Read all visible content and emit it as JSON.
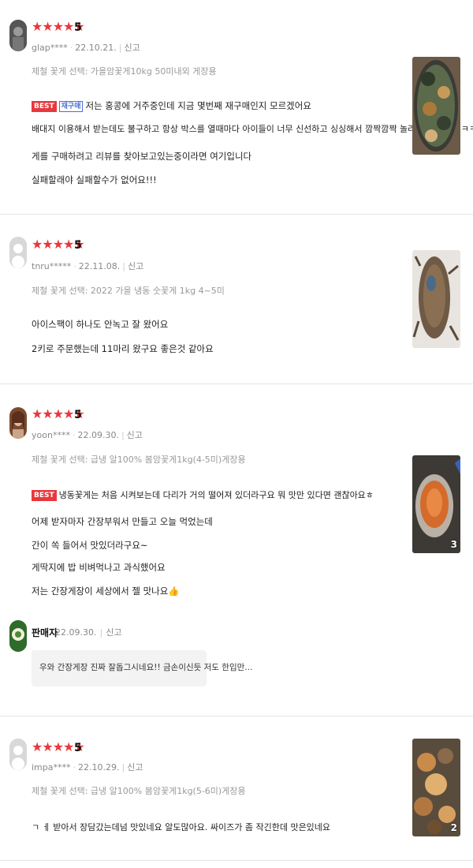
{
  "reviews": [
    {
      "stars": "★★★★★",
      "score": "5",
      "user": "glap****",
      "date": "22.10.21.",
      "report": "신고",
      "option": "제철 꽃게 선택: 가을암꽃게10kg 50미내외 게장용",
      "badges": [
        "BEST",
        "재구매"
      ],
      "lines": [
        "저는 홍콩에 거주중인데 지금 몇번째 재구매인지 모르겠어요",
        "배대지 이용해서 받는데도 불구하고 항상 박스를 열때마다 아이들이 너무 신선하고 싱싱해서 깜짝깜짝 놀라고 있습니다 ㅋㅋ",
        "게를 구매하려고 리뷰를 찾아보고있는중이라면 여기입니다",
        "실패할래야 실패할수가 없어요!!!"
      ],
      "photo_count": ""
    },
    {
      "stars": "★★★★★",
      "score": "5",
      "user": "tnru*****",
      "date": "22.11.08.",
      "report": "신고",
      "option": "제철 꽃게 선택: 2022 가을 냉동 숫꽃게 1kg 4~5미",
      "badges": [],
      "lines": [
        "아이스팩이 하나도 안녹고 잘 왔어요",
        "2키로 주문했는데 11마리 왔구요 좋은것 같아요"
      ],
      "photo_count": ""
    },
    {
      "stars": "★★★★★",
      "score": "5",
      "user": "yoon****",
      "date": "22.09.30.",
      "report": "신고",
      "option": "제철 꽃게 선택: 급냉 알100% 봄암꽃게1kg(4-5미)게장용",
      "badges": [
        "BEST"
      ],
      "lines": [
        "냉동꽃게는 처음 시켜보는데 다리가 거의 떨어져 있더라구요 뭐 맛만 있다면 괜찮아요ㅎ",
        "어제 받자마자 간장부워서 만들고 오늘 먹었는데",
        "간이 쏙 들어서 맛있더라구요~",
        "게딱지에 밥 비벼먹나고 과식했어요",
        "저는 간장게장이 세상에서 젤 맛나요👍"
      ],
      "photo_count": "3",
      "seller_reply": {
        "name": "판매자",
        "date": "22.09.30.",
        "report": "신고",
        "text": "우와 간장게장 진짜 잘돕그시네요!! 금손이신듯 저도 한입만..."
      }
    },
    {
      "stars": "★★★★★",
      "score": "5",
      "user": "impa****",
      "date": "22.10.29.",
      "report": "신고",
      "option": "제철 꽃게 선택: 급냉 알100% 봄암꽃게1kg(5-6미)게장용",
      "badges": [],
      "lines": [
        "ㄱ ㅔ 받아서 장담갔는데넘 맛있네요 알도많아요. 싸이즈가 좀 작긴한데 맛은있네요"
      ],
      "photo_count": "2"
    }
  ]
}
